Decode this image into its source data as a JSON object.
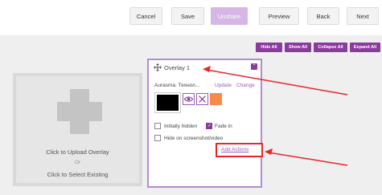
{
  "toolbar": {
    "cancel": "Cancel",
    "save": "Save",
    "unshare": "Unshare",
    "preview": "Preview",
    "back": "Back",
    "next": "Next"
  },
  "panel_actions": {
    "hide_all": "Hide All",
    "show_all": "Show All",
    "collapse_all": "Collapse All",
    "expand_all": "Expand All"
  },
  "upload": {
    "click_upload": "Click to Upload Overlay",
    "or": "Or",
    "click_select": "Click to Select Existing"
  },
  "overlay": {
    "title": "Overlay 1",
    "aura_name": "Aurasma. Технол...",
    "update_link": "Update",
    "change_link": "Change",
    "swatch_color": "#f58a4b",
    "initially_hidden_label": "Initially hidden",
    "initially_hidden_checked": false,
    "fade_in_label": "Fade in",
    "fade_in_checked": true,
    "hide_on_screenshot_label": "Hide on screenshot/video",
    "hide_on_screenshot_checked": false,
    "add_actions": "Add Actions"
  },
  "colors": {
    "accent": "#8a3b9c",
    "accent_light": "#d6b6e4",
    "annotation_red": "#e8262a"
  }
}
